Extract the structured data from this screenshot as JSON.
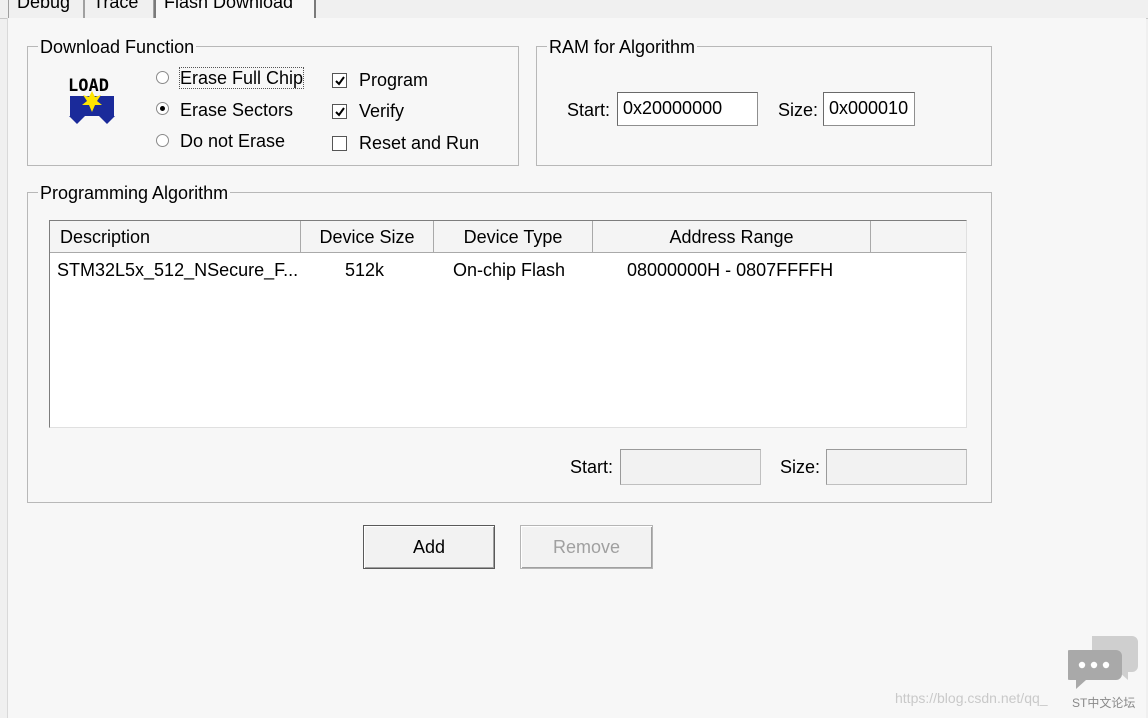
{
  "tabs": [
    {
      "label": "Debug"
    },
    {
      "label": "Trace"
    },
    {
      "label": "Flash Download"
    }
  ],
  "download_function": {
    "title": "Download Function",
    "icon_text": "LOAD",
    "radios": [
      {
        "label": "Erase Full Chip",
        "selected": false
      },
      {
        "label": "Erase Sectors",
        "selected": true
      },
      {
        "label": "Do not Erase",
        "selected": false
      }
    ],
    "checks": [
      {
        "label": "Program",
        "checked": true
      },
      {
        "label": "Verify",
        "checked": true
      },
      {
        "label": "Reset and Run",
        "checked": false
      }
    ]
  },
  "ram": {
    "title": "RAM for Algorithm",
    "start_label": "Start:",
    "start_value": "0x20000000",
    "size_label": "Size:",
    "size_value": "0x000010"
  },
  "programming": {
    "title": "Programming Algorithm",
    "columns": [
      "Description",
      "Device Size",
      "Device Type",
      "Address Range"
    ],
    "rows": [
      [
        "STM32L5x_512_NSecure_F...",
        "512k",
        "On-chip Flash",
        "08000000H - 0807FFFFH"
      ]
    ],
    "start_label": "Start:",
    "start_value": "",
    "size_label": "Size:",
    "size_value": ""
  },
  "buttons": {
    "add": "Add",
    "remove": "Remove"
  },
  "watermark": {
    "url": "https://blog.csdn.net/qq_",
    "forum": "ST中文论坛"
  }
}
